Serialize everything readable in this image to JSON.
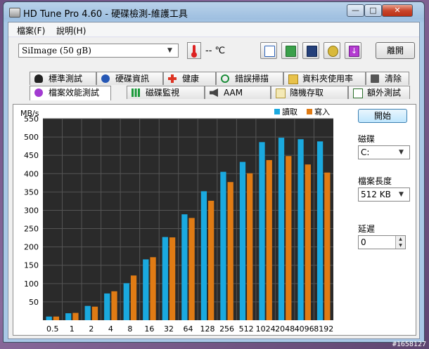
{
  "window": {
    "title": "HD Tune Pro 4.60 - 硬碟檢測-維護工具"
  },
  "menu": {
    "items": [
      "檔案(F)",
      "說明(H)"
    ]
  },
  "toolbar": {
    "drive": "SiImage  (50 gB)",
    "temperature": "-- ℃",
    "exit_label": "離開"
  },
  "tabs_row1": [
    "標準測試",
    "硬碟資訊",
    "健康",
    "錯誤掃描",
    "資料夾使用率",
    "清除"
  ],
  "tabs_row2": [
    "檔案效能測試",
    "磁碟監視",
    "AAM",
    "隨機存取",
    "額外測試"
  ],
  "side": {
    "start_label": "開始",
    "disk_label": "磁碟",
    "disk_value": "C:",
    "filesize_label": "檔案長度",
    "filesize_value": "512 KB",
    "delay_label": "延遲",
    "delay_value": "0"
  },
  "colors": {
    "read": "#1aa9df",
    "write": "#e07b14",
    "plot_bg": "#2a2a2a"
  },
  "watermark": "#1658127",
  "chart_data": {
    "type": "bar",
    "ylabel": "MB/s",
    "ylim": [
      0,
      550
    ],
    "yticks": [
      50,
      100,
      150,
      200,
      250,
      300,
      350,
      400,
      450,
      500,
      550
    ],
    "categories": [
      "0.5",
      "1",
      "2",
      "4",
      "8",
      "16",
      "32",
      "64",
      "128",
      "256",
      "512",
      "1024",
      "2048",
      "4096",
      "8192"
    ],
    "series": [
      {
        "name": "讀取",
        "values": [
          10,
          19,
          39,
          73,
          101,
          166,
          227,
          289,
          352,
          405,
          432,
          486,
          498,
          494,
          488
        ]
      },
      {
        "name": "寫入",
        "values": [
          10,
          20,
          37,
          79,
          122,
          172,
          226,
          279,
          326,
          377,
          401,
          437,
          448,
          425,
          403
        ]
      }
    ],
    "grid": true,
    "legend": "top-right"
  }
}
